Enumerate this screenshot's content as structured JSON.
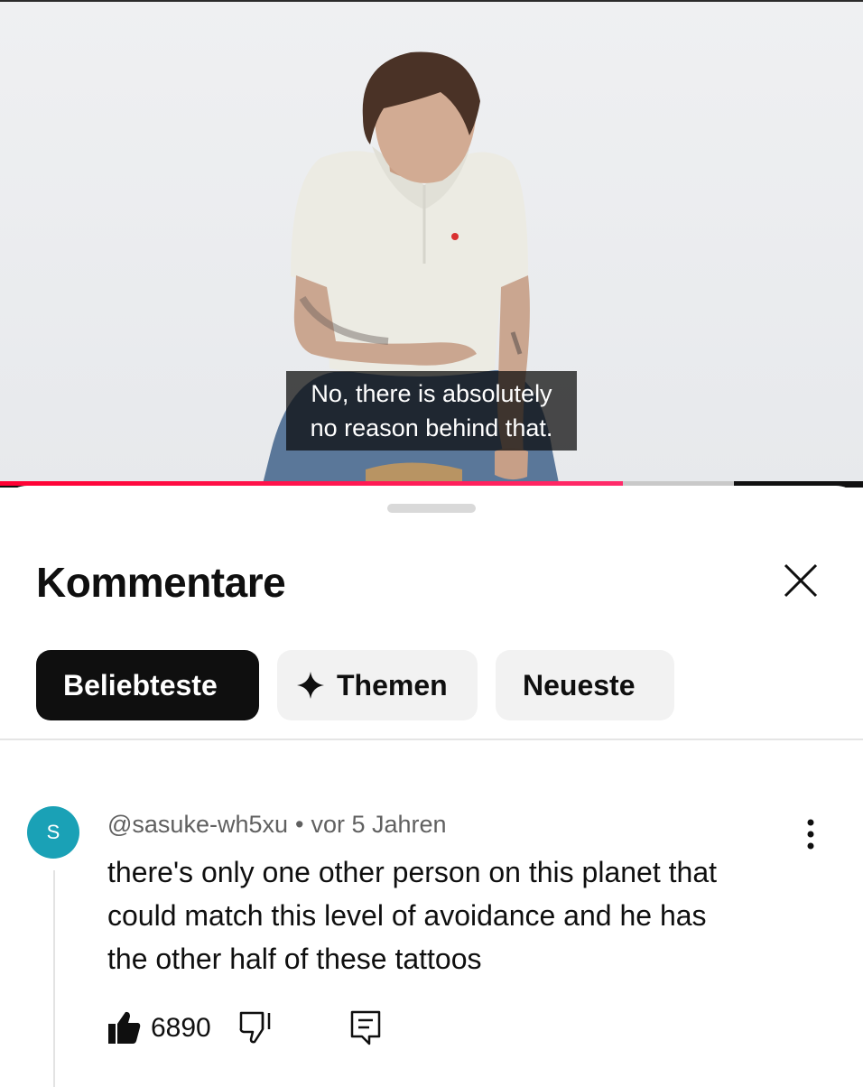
{
  "video": {
    "subtitle_lines": [
      "No, there is absolutely",
      "no reason behind that."
    ],
    "progress_fraction": 0.722,
    "progress_color": "#ff0033"
  },
  "sheet": {
    "title": "Kommentare",
    "close_icon": "close-icon"
  },
  "chips": [
    {
      "label": "Beliebteste",
      "active": true
    },
    {
      "label": "Themen",
      "icon": "sparkle-icon",
      "active": false
    },
    {
      "label": "Neueste",
      "active": false
    }
  ],
  "comment": {
    "avatar_letter": "S",
    "avatar_color": "#1aa1b6",
    "author": "@sasuke-wh5xu",
    "separator": "•",
    "time": "vor 5 Jahren",
    "text_lines": [
      "there's only one other person on this planet that",
      "could match this level of avoidance and he has",
      "the other half of these tattoos"
    ],
    "likes": "6890",
    "icons": [
      "thumbs-up-icon",
      "thumbs-down-icon",
      "reply-icon",
      "more-vertical-icon"
    ]
  }
}
